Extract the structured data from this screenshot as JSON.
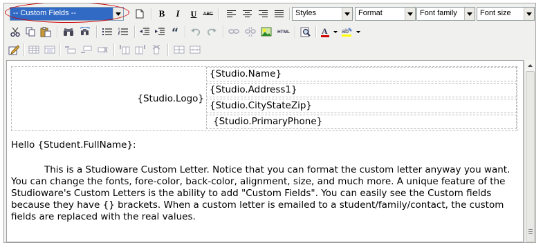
{
  "toolbar": {
    "custom_fields": "-- Custom Fields --",
    "styles": "Styles",
    "format": "Format",
    "font_family": "Font family",
    "font_size": "Font size",
    "bold": "B",
    "italic": "I",
    "underline": "U",
    "strikethrough": "ABC",
    "html": "HTML",
    "quote": "“"
  },
  "content": {
    "header": {
      "logo": "{Studio.Logo}",
      "fields": [
        "{Studio.Name}",
        "{Studio.Address1}",
        "{Studio.CityStateZip}",
        "{Studio.PrimaryPhone}"
      ]
    },
    "greeting": "Hello {Student.FullName}:",
    "paragraph": "This is a Studioware Custom Letter.  Notice that you can format the custom letter anyway you want.  You can change the fonts, fore-color, back-color, alignment, size, and much more.  A unique feature of the Studioware's Custom Letters is the ability to add \"Custom Fields\".  You can easily see the Custom fields because they have {} brackets.  When a custom letter is emailed to a student/family/contact, the custom fields are replaced with the real values."
  },
  "colors": {
    "toolbar_bg": "#f0f0ee",
    "selected_bg": "#316ac5",
    "highlight_oval": "#cc0000",
    "text_color_a": "#cc0000",
    "background_color_ab": "#ffff00"
  }
}
